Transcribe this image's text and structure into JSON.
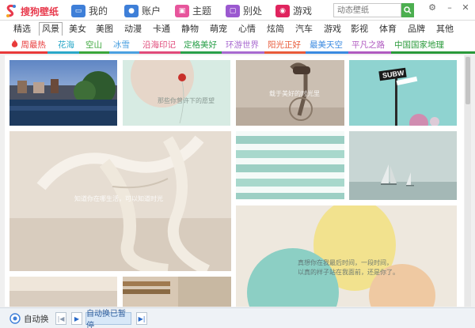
{
  "app": {
    "title": "搜狗壁纸",
    "colors": {
      "brand": "#e83a4d",
      "search": "#4caf50"
    }
  },
  "toptabs": [
    {
      "label": "我的",
      "icon": "monitor-icon",
      "color": "#3e7fd8"
    },
    {
      "label": "账户",
      "icon": "user-icon",
      "color": "#3e7fd8"
    },
    {
      "label": "主题",
      "icon": "theme-icon",
      "color": "#e7559c"
    },
    {
      "label": "别处",
      "icon": "tv-icon",
      "color": "#9b59d0"
    },
    {
      "label": "游戏",
      "icon": "gamepad-icon",
      "color": "#e0245e"
    }
  ],
  "search": {
    "placeholder": "动态壁纸"
  },
  "categories": [
    "精选",
    "风景",
    "美女",
    "美图",
    "动漫",
    "卡通",
    "静物",
    "萌宠",
    "心情",
    "炫简",
    "汽车",
    "游戏",
    "影视",
    "体育",
    "品牌",
    "其他"
  ],
  "active_category": "风景",
  "tags": [
    {
      "label": "周最热",
      "color": "#e83a3a"
    },
    {
      "label": "花海",
      "color": "#2aa8c8"
    },
    {
      "label": "空山",
      "color": "#3aa63a"
    },
    {
      "label": "冰雪",
      "color": "#4aa0e0"
    },
    {
      "label": "沿海印记",
      "color": "#e04a7a"
    },
    {
      "label": "定格美好",
      "color": "#2aa04a"
    },
    {
      "label": "环游世界",
      "color": "#a86ad0"
    },
    {
      "label": "阳光正好",
      "color": "#e85a3a"
    },
    {
      "label": "最美天空",
      "color": "#3a8ae0"
    },
    {
      "label": "平凡之路",
      "color": "#b05ac0"
    },
    {
      "label": "中国国家地理",
      "color": "#2a9a3a"
    }
  ],
  "tiles": {
    "balloon_caption": "那些你曾许下的愿望",
    "bike_caption": "载于美好的时光里",
    "rope_caption": "知道你在哪生活，可以知道时光",
    "balloons_caption_1": "真想你在我最后时间，一段时间，",
    "balloons_caption_2": "以真的样子站在我面前，还是你了。"
  },
  "bottom": {
    "auto_label": "自动换",
    "status_label": "自动换已暂停"
  }
}
